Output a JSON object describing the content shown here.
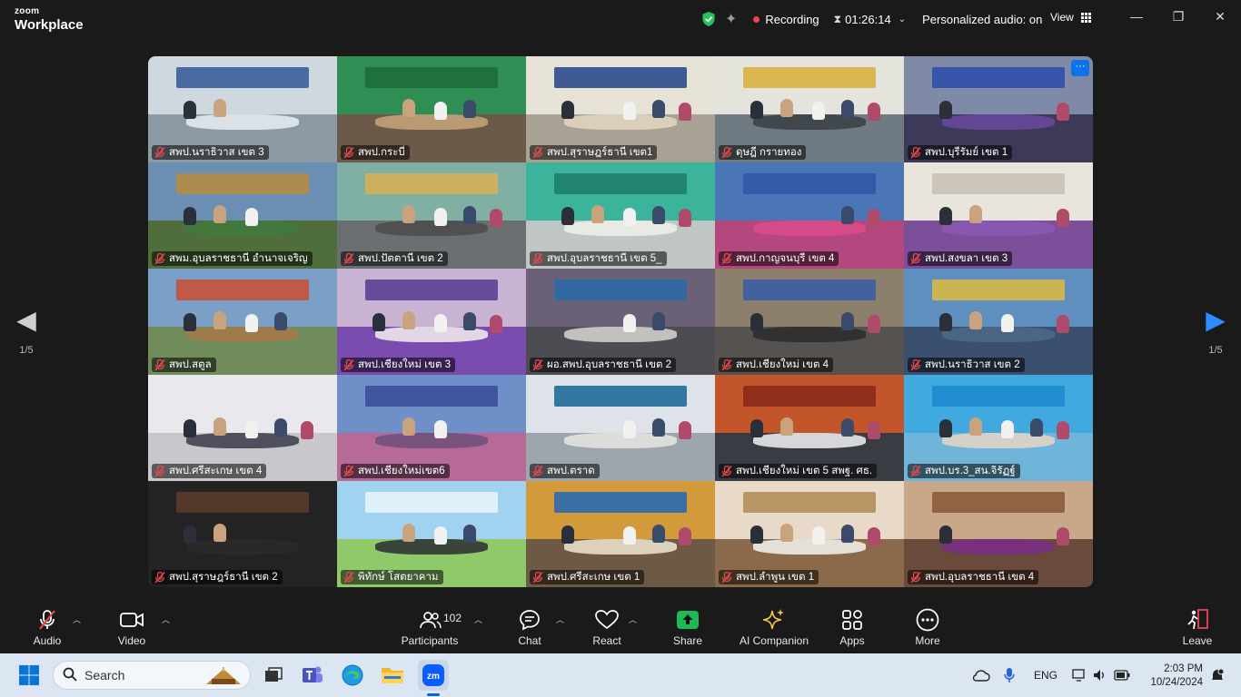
{
  "app": {
    "brand_top": "zoom",
    "brand_bottom": "Workplace"
  },
  "status": {
    "recording_label": "Recording",
    "timer": "01:26:14",
    "personalized_audio": "Personalized audio: on",
    "view_label": "View"
  },
  "gallery": {
    "page_left": "1/5",
    "page_right": "1/5",
    "tiles": [
      {
        "name": "สพป.นราธิวาส เขต 3",
        "wall": "#cfd8de",
        "floor": "#8c9aa6",
        "banner": "#3a5f9a",
        "desk": "#e9eef2"
      },
      {
        "name": "สพป.กระบี่",
        "wall": "#2f8e54",
        "floor": "#6b5a4a",
        "banner": "#1e6b3d",
        "desk": "#c8a679"
      },
      {
        "name": "สพป.สุราษฎร์ธานี เขต1",
        "wall": "#e6e2d6",
        "floor": "#a8a294",
        "banner": "#2b4a8c",
        "desk": "#e4d7bf"
      },
      {
        "name": "ดุษฎี กรายทอง",
        "wall": "#e5e4dc",
        "floor": "#6f7a82",
        "banner": "#d9b040",
        "desk": "#3a3f44"
      },
      {
        "name": "สพป.บุรีรัมย์ เขต 1",
        "wall": "#7f8aa6",
        "floor": "#3d3a59",
        "banner": "#2f4fa8",
        "desk": "#6a4aa0"
      },
      {
        "name": "สพม.อุบลราชธานี อำนาจเจริญ",
        "wall": "#6b8fb2",
        "floor": "#4f6e3c",
        "banner": "#b58a44",
        "desk": "#3f7a3c"
      },
      {
        "name": "สพป.ปัตตานี เขต 2",
        "wall": "#7fb0a3",
        "floor": "#6c6f72",
        "banner": "#d6b057",
        "desk": "#4b4b4b"
      },
      {
        "name": "สพป.อุบลราชธานี เขต 5_",
        "wall": "#3cb39b",
        "floor": "#c0c6c4",
        "banner": "#1f7f6e",
        "desk": "#f0f0ea"
      },
      {
        "name": "สพป.กาญจนบุรี เขต 4",
        "wall": "#4a76b8",
        "floor": "#b5477f",
        "banner": "#2f59a6",
        "desk": "#d94c8a"
      },
      {
        "name": "สพป.สงขลา เขต 3",
        "wall": "#e9e5dc",
        "floor": "#7c4f9a",
        "banner": "#c8c2b5",
        "desk": "#8b59b5"
      },
      {
        "name": "สพป.สตูล",
        "wall": "#7aa0c8",
        "floor": "#6f8c5a",
        "banner": "#c8513a",
        "desk": "#a8784a"
      },
      {
        "name": "สพป.เชียงใหม่ เขต 3",
        "wall": "#c8b4d2",
        "floor": "#7b4cb0",
        "banner": "#5a3f93",
        "desk": "#f3f0ee"
      },
      {
        "name": "ผอ.สพป.อุบลราชธานี เขต 2",
        "wall": "#6a6178",
        "floor": "#4c4c52",
        "banner": "#2e6aa6",
        "desk": "#d8d6d2"
      },
      {
        "name": "สพป.เชียงใหม่ เขต 4",
        "wall": "#8c7f6c",
        "floor": "#55524f",
        "banner": "#3b5ea3",
        "desk": "#2b2b2b"
      },
      {
        "name": "สพป.นราธิวาส เขต 2",
        "wall": "#5f8fbf",
        "floor": "#3b4f6e",
        "banner": "#d9b846",
        "desk": "#4c6a8a"
      },
      {
        "name": "สพป.ศรีสะเกษ เขต 4",
        "wall": "#e9e8ec",
        "floor": "#c8c8cc",
        "banner": "#e9e8ec",
        "desk": "#3a3a4a"
      },
      {
        "name": "สพป.เชียงใหม่เขต6",
        "wall": "#6f8fc8",
        "floor": "#b86a96",
        "banner": "#3a4f9a",
        "desk": "#6b4f7a"
      },
      {
        "name": "สพป.ตราด",
        "wall": "#dde3e8",
        "floor": "#9da6ad",
        "banner": "#1f6a9a",
        "desk": "#e8e6e0"
      },
      {
        "name": "สพป.เชียงใหม่ เขต 5 สพฐ. ศธ.",
        "wall": "#c2562a",
        "floor": "#3a3c44",
        "banner": "#8a2a1a",
        "desk": "#f2f2f2"
      },
      {
        "name": "สพป.บร.3_สน.จิรัฏฐ์",
        "wall": "#3fa9e0",
        "floor": "#6fb5d9",
        "banner": "#1d8ad0",
        "desk": "#e8d6c6"
      },
      {
        "name": "สพป.สุราษฎร์ธานี เขต 2",
        "wall": "#232323",
        "floor": "#232323",
        "banner": "#5a3b2a",
        "desk": "#2a2a2a"
      },
      {
        "name": "พิทักษ์ โสตยาคาม",
        "wall": "#9fd3f0",
        "floor": "#8fc96a",
        "banner": "#e5f3fb",
        "desk": "#2a2d33"
      },
      {
        "name": "สพป.ศรีสะเกษ เขต 1",
        "wall": "#d29a3a",
        "floor": "#6e5a44",
        "banner": "#2b6ab0",
        "desk": "#f0e6d0"
      },
      {
        "name": "สพป.ลำพูน เขต 1",
        "wall": "#e9d9c8",
        "floor": "#8a6a4a",
        "banner": "#b38d5a",
        "desk": "#f4f4f0"
      },
      {
        "name": "สพป.อุบลราชธานี เขต 4",
        "wall": "#c9a88a",
        "floor": "#6a4a3a",
        "banner": "#8b5a3c",
        "desk": "#7a2a8a"
      }
    ]
  },
  "toolbar": {
    "audio": "Audio",
    "video": "Video",
    "participants": "Participants",
    "participant_count": "102",
    "chat": "Chat",
    "react": "React",
    "share": "Share",
    "ai_companion": "AI Companion",
    "apps": "Apps",
    "more": "More",
    "leave": "Leave"
  },
  "taskbar": {
    "search_placeholder": "Search",
    "lang": "ENG",
    "time": "2:03 PM",
    "date": "10/24/2024"
  },
  "colors": {
    "accent": "#0e72ed",
    "share_green": "#1db954",
    "record_red": "#e5484d",
    "security_green": "#22c55e"
  }
}
